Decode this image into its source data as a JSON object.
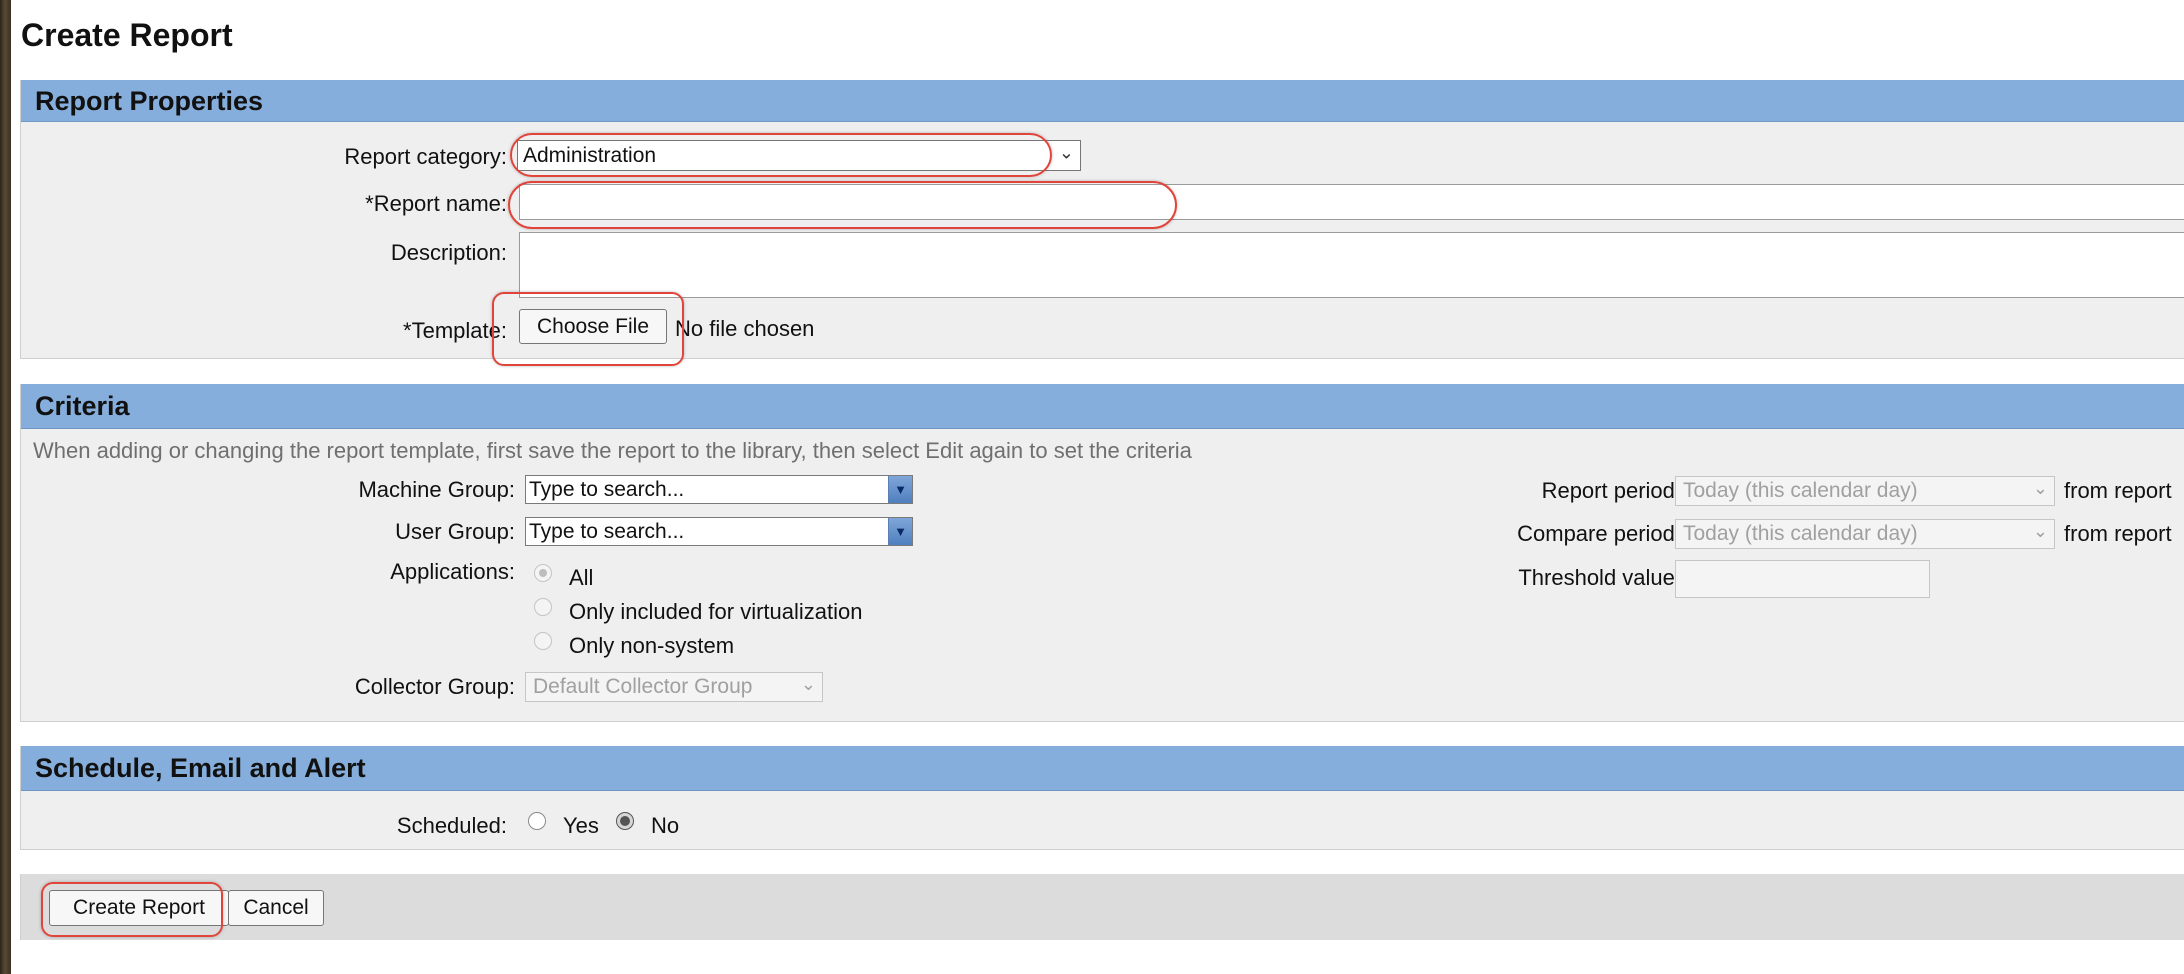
{
  "page": {
    "title": "Create Report"
  },
  "report_properties": {
    "header": "Report Properties",
    "category_label": "Report category:",
    "category_value": "Administration",
    "name_label": "*Report name:",
    "name_value": "",
    "description_label": "Description:",
    "description_value": "",
    "template_label": "*Template:",
    "choose_file_label": "Choose File",
    "no_file_text": "No file chosen"
  },
  "criteria": {
    "header": "Criteria",
    "note": "When adding or changing the report template, first save the report to the library, then select Edit again to set the criteria",
    "machine_group_label": "Machine Group:",
    "machine_group_placeholder": "Type to search...",
    "user_group_label": "User Group:",
    "user_group_placeholder": "Type to search...",
    "applications_label": "Applications:",
    "applications_options": [
      "All",
      "Only included for virtualization",
      "Only non-system"
    ],
    "applications_selected": "All",
    "collector_group_label": "Collector Group:",
    "collector_group_value": "Default Collector Group",
    "report_period_label": "Report period:",
    "report_period_value": "Today (this calendar day)",
    "report_period_suffix": "from report",
    "compare_period_label": "Compare period:",
    "compare_period_value": "Today (this calendar day)",
    "compare_period_suffix": "from report",
    "threshold_label": "Threshold value:",
    "threshold_value": ""
  },
  "schedule": {
    "header": "Schedule, Email and Alert",
    "scheduled_label": "Scheduled:",
    "yes_label": "Yes",
    "no_label": "No",
    "selected": "No"
  },
  "actions": {
    "create_label": "Create Report",
    "cancel_label": "Cancel"
  },
  "colors": {
    "section_header": "#86aedc",
    "section_body": "#efefef",
    "annotation": "#e0443a"
  }
}
